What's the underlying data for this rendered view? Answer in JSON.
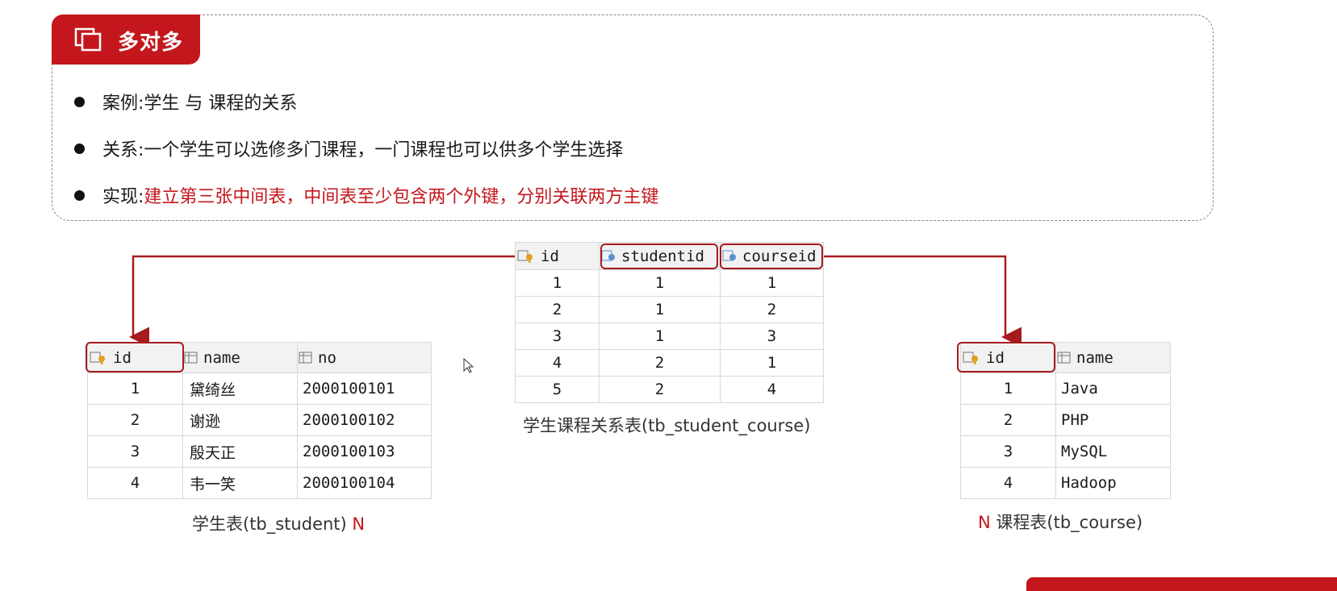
{
  "tab": {
    "title": "多对多"
  },
  "bullets": [
    {
      "label": "案例: ",
      "text": "学生 与 课程的关系",
      "highlight": false
    },
    {
      "label": "关系: ",
      "text": "一个学生可以选修多门课程，一门课程也可以供多个学生选择",
      "highlight": false
    },
    {
      "label": "实现: ",
      "text": "建立第三张中间表，中间表至少包含两个外键，分别关联两方主键",
      "highlight": true
    }
  ],
  "colors": {
    "accent": "#c3171d",
    "highlight_box": "#a61b1e"
  },
  "student_table": {
    "columns": [
      "id",
      "name",
      "no"
    ],
    "rows": [
      [
        "1",
        "黛绮丝",
        "2000100101"
      ],
      [
        "2",
        "谢逊",
        "2000100102"
      ],
      [
        "3",
        "殷天正",
        "2000100103"
      ],
      [
        "4",
        "韦一笑",
        "2000100104"
      ]
    ],
    "caption": "学生表(tb_student)",
    "cardinality": "N"
  },
  "link_table": {
    "columns": [
      "id",
      "studentid",
      "courseid"
    ],
    "rows": [
      [
        "1",
        "1",
        "1"
      ],
      [
        "2",
        "1",
        "2"
      ],
      [
        "3",
        "1",
        "3"
      ],
      [
        "4",
        "2",
        "1"
      ],
      [
        "5",
        "2",
        "4"
      ]
    ],
    "caption": "学生课程关系表(tb_student_course)"
  },
  "course_table": {
    "columns": [
      "id",
      "name"
    ],
    "rows": [
      [
        "1",
        "Java"
      ],
      [
        "2",
        "PHP"
      ],
      [
        "3",
        "MySQL"
      ],
      [
        "4",
        "Hadoop"
      ]
    ],
    "caption": "课程表(tb_course)",
    "cardinality": "N"
  },
  "icons": {
    "tab": "copy-icon",
    "primary_key": "key-column-icon",
    "foreign_key": "foreign-key-icon",
    "column": "column-icon",
    "cursor": "mouse-cursor-icon"
  }
}
